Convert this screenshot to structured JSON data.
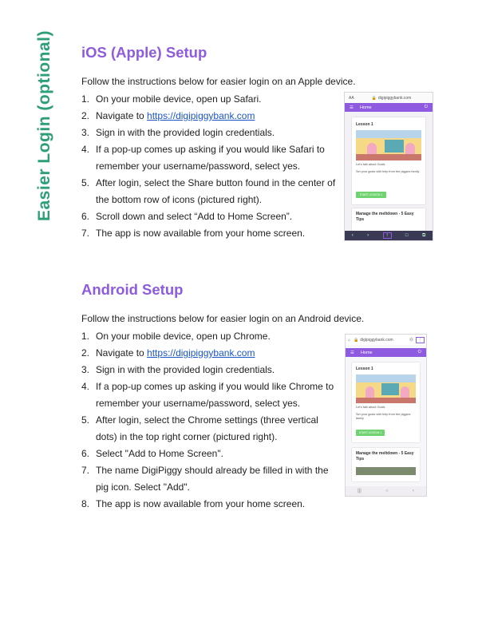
{
  "side_title": "Easier Login (optional)",
  "ios": {
    "heading": "iOS (Apple) Setup",
    "intro": "Follow the instructions below for easier login on an Apple device.",
    "steps": [
      {
        "num": "1.",
        "text": "On your mobile device, open up Safari."
      },
      {
        "num": "2.",
        "text": "Navigate to ",
        "link": "https://digipiggybank.com"
      },
      {
        "num": "3.",
        "text": "Sign in with the provided login credentials."
      },
      {
        "num": "4.",
        "text": "If a pop-up comes up asking if you would like Safari to remember your username/password, select yes."
      },
      {
        "num": "5.",
        "text": "After login, select the Share button found in the center of the bottom row of icons (pictured right)."
      },
      {
        "num": "6.",
        "text": "Scroll down and select “Add to Home Screen”."
      },
      {
        "num": "7.",
        "text": "The app is now available from your home screen."
      }
    ],
    "phone": {
      "url_left": "AA",
      "url": "digipiggybank.com",
      "appbar_title": "Home",
      "card_title": "Lesson 1",
      "card_line1": "Let's talk about Goals",
      "card_line2": "Set your goals with help from the piggies family",
      "card_button": "START LESSON 1",
      "card2_title": "Manage the meltdown - 5 Easy Tips"
    }
  },
  "android": {
    "heading": "Android Setup",
    "intro": "Follow the instructions below for easier login on an Android device.",
    "steps": [
      {
        "num": "1.",
        "text": "On your mobile device, open up Chrome."
      },
      {
        "num": "2.",
        "text": "Navigate to ",
        "link": "https://digipiggybank.com"
      },
      {
        "num": "3.",
        "text": "Sign in with the provided login credentials."
      },
      {
        "num": "4.",
        "text": "If a pop-up comes up asking if you would like Chrome to remember your username/password, select yes."
      },
      {
        "num": "5.",
        "text": "After login, select the Chrome settings (three vertical dots) in the top right corner (pictured right)."
      },
      {
        "num": "6.",
        "text": "Select \"Add to Home Screen\"."
      },
      {
        "num": "7.",
        "text": "The name DigiPiggy should already be filled in with the pig icon. Select \"Add\"."
      },
      {
        "num": "8.",
        "text": "The app is now available from your home screen."
      }
    ],
    "phone": {
      "url": "digipiggybank.com",
      "appbar_title": "Home",
      "card_title": "Lesson 1",
      "card_line1": "Let's talk about Goals",
      "card_line2": "Set your goals with help from the piggies family",
      "card_button": "START LESSON 1",
      "card2_title": "Manage the meltdown - 5 Easy Tips"
    }
  },
  "colors": {
    "heading": "#8e5be0",
    "side_title": "#2e9e79",
    "link": "#1a55c8"
  }
}
